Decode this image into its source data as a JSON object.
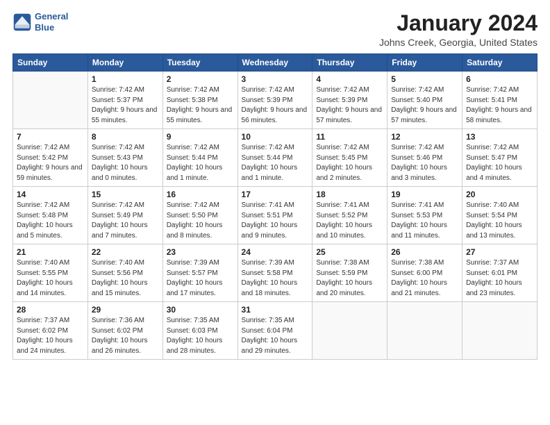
{
  "logo": {
    "line1": "General",
    "line2": "Blue"
  },
  "title": "January 2024",
  "subtitle": "Johns Creek, Georgia, United States",
  "days_of_week": [
    "Sunday",
    "Monday",
    "Tuesday",
    "Wednesday",
    "Thursday",
    "Friday",
    "Saturday"
  ],
  "weeks": [
    [
      {
        "num": "",
        "sunrise": "",
        "sunset": "",
        "daylight": ""
      },
      {
        "num": "1",
        "sunrise": "Sunrise: 7:42 AM",
        "sunset": "Sunset: 5:37 PM",
        "daylight": "Daylight: 9 hours and 55 minutes."
      },
      {
        "num": "2",
        "sunrise": "Sunrise: 7:42 AM",
        "sunset": "Sunset: 5:38 PM",
        "daylight": "Daylight: 9 hours and 55 minutes."
      },
      {
        "num": "3",
        "sunrise": "Sunrise: 7:42 AM",
        "sunset": "Sunset: 5:39 PM",
        "daylight": "Daylight: 9 hours and 56 minutes."
      },
      {
        "num": "4",
        "sunrise": "Sunrise: 7:42 AM",
        "sunset": "Sunset: 5:39 PM",
        "daylight": "Daylight: 9 hours and 57 minutes."
      },
      {
        "num": "5",
        "sunrise": "Sunrise: 7:42 AM",
        "sunset": "Sunset: 5:40 PM",
        "daylight": "Daylight: 9 hours and 57 minutes."
      },
      {
        "num": "6",
        "sunrise": "Sunrise: 7:42 AM",
        "sunset": "Sunset: 5:41 PM",
        "daylight": "Daylight: 9 hours and 58 minutes."
      }
    ],
    [
      {
        "num": "7",
        "sunrise": "Sunrise: 7:42 AM",
        "sunset": "Sunset: 5:42 PM",
        "daylight": "Daylight: 9 hours and 59 minutes."
      },
      {
        "num": "8",
        "sunrise": "Sunrise: 7:42 AM",
        "sunset": "Sunset: 5:43 PM",
        "daylight": "Daylight: 10 hours and 0 minutes."
      },
      {
        "num": "9",
        "sunrise": "Sunrise: 7:42 AM",
        "sunset": "Sunset: 5:44 PM",
        "daylight": "Daylight: 10 hours and 1 minute."
      },
      {
        "num": "10",
        "sunrise": "Sunrise: 7:42 AM",
        "sunset": "Sunset: 5:44 PM",
        "daylight": "Daylight: 10 hours and 1 minute."
      },
      {
        "num": "11",
        "sunrise": "Sunrise: 7:42 AM",
        "sunset": "Sunset: 5:45 PM",
        "daylight": "Daylight: 10 hours and 2 minutes."
      },
      {
        "num": "12",
        "sunrise": "Sunrise: 7:42 AM",
        "sunset": "Sunset: 5:46 PM",
        "daylight": "Daylight: 10 hours and 3 minutes."
      },
      {
        "num": "13",
        "sunrise": "Sunrise: 7:42 AM",
        "sunset": "Sunset: 5:47 PM",
        "daylight": "Daylight: 10 hours and 4 minutes."
      }
    ],
    [
      {
        "num": "14",
        "sunrise": "Sunrise: 7:42 AM",
        "sunset": "Sunset: 5:48 PM",
        "daylight": "Daylight: 10 hours and 5 minutes."
      },
      {
        "num": "15",
        "sunrise": "Sunrise: 7:42 AM",
        "sunset": "Sunset: 5:49 PM",
        "daylight": "Daylight: 10 hours and 7 minutes."
      },
      {
        "num": "16",
        "sunrise": "Sunrise: 7:42 AM",
        "sunset": "Sunset: 5:50 PM",
        "daylight": "Daylight: 10 hours and 8 minutes."
      },
      {
        "num": "17",
        "sunrise": "Sunrise: 7:41 AM",
        "sunset": "Sunset: 5:51 PM",
        "daylight": "Daylight: 10 hours and 9 minutes."
      },
      {
        "num": "18",
        "sunrise": "Sunrise: 7:41 AM",
        "sunset": "Sunset: 5:52 PM",
        "daylight": "Daylight: 10 hours and 10 minutes."
      },
      {
        "num": "19",
        "sunrise": "Sunrise: 7:41 AM",
        "sunset": "Sunset: 5:53 PM",
        "daylight": "Daylight: 10 hours and 11 minutes."
      },
      {
        "num": "20",
        "sunrise": "Sunrise: 7:40 AM",
        "sunset": "Sunset: 5:54 PM",
        "daylight": "Daylight: 10 hours and 13 minutes."
      }
    ],
    [
      {
        "num": "21",
        "sunrise": "Sunrise: 7:40 AM",
        "sunset": "Sunset: 5:55 PM",
        "daylight": "Daylight: 10 hours and 14 minutes."
      },
      {
        "num": "22",
        "sunrise": "Sunrise: 7:40 AM",
        "sunset": "Sunset: 5:56 PM",
        "daylight": "Daylight: 10 hours and 15 minutes."
      },
      {
        "num": "23",
        "sunrise": "Sunrise: 7:39 AM",
        "sunset": "Sunset: 5:57 PM",
        "daylight": "Daylight: 10 hours and 17 minutes."
      },
      {
        "num": "24",
        "sunrise": "Sunrise: 7:39 AM",
        "sunset": "Sunset: 5:58 PM",
        "daylight": "Daylight: 10 hours and 18 minutes."
      },
      {
        "num": "25",
        "sunrise": "Sunrise: 7:38 AM",
        "sunset": "Sunset: 5:59 PM",
        "daylight": "Daylight: 10 hours and 20 minutes."
      },
      {
        "num": "26",
        "sunrise": "Sunrise: 7:38 AM",
        "sunset": "Sunset: 6:00 PM",
        "daylight": "Daylight: 10 hours and 21 minutes."
      },
      {
        "num": "27",
        "sunrise": "Sunrise: 7:37 AM",
        "sunset": "Sunset: 6:01 PM",
        "daylight": "Daylight: 10 hours and 23 minutes."
      }
    ],
    [
      {
        "num": "28",
        "sunrise": "Sunrise: 7:37 AM",
        "sunset": "Sunset: 6:02 PM",
        "daylight": "Daylight: 10 hours and 24 minutes."
      },
      {
        "num": "29",
        "sunrise": "Sunrise: 7:36 AM",
        "sunset": "Sunset: 6:02 PM",
        "daylight": "Daylight: 10 hours and 26 minutes."
      },
      {
        "num": "30",
        "sunrise": "Sunrise: 7:35 AM",
        "sunset": "Sunset: 6:03 PM",
        "daylight": "Daylight: 10 hours and 28 minutes."
      },
      {
        "num": "31",
        "sunrise": "Sunrise: 7:35 AM",
        "sunset": "Sunset: 6:04 PM",
        "daylight": "Daylight: 10 hours and 29 minutes."
      },
      {
        "num": "",
        "sunrise": "",
        "sunset": "",
        "daylight": ""
      },
      {
        "num": "",
        "sunrise": "",
        "sunset": "",
        "daylight": ""
      },
      {
        "num": "",
        "sunrise": "",
        "sunset": "",
        "daylight": ""
      }
    ]
  ]
}
